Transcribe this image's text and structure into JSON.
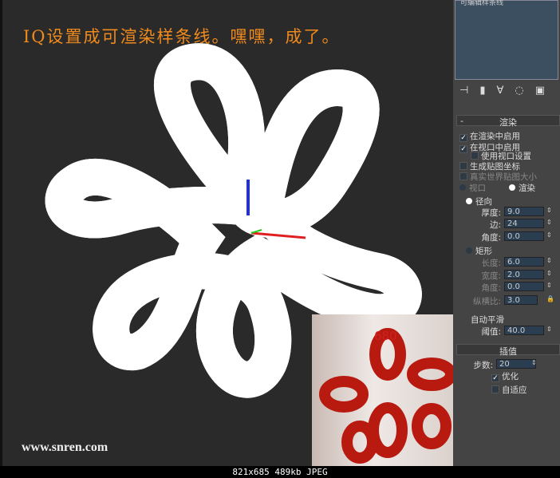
{
  "viewport": {
    "caption": "IQ设置成可渲染样条线。嘿嘿，成了。",
    "watermark": "www.snren.com",
    "photo_label": "680"
  },
  "panel": {
    "list_title": "可编辑样条线",
    "icons": [
      "pin-icon",
      "stack-icon",
      "funnel-icon",
      "lock-icon",
      "config-icon"
    ],
    "rendering": {
      "header": "渲染",
      "collapse": "-",
      "enable_render": {
        "label": "在渲染中启用",
        "checked": true
      },
      "enable_viewport": {
        "label": "在视口中启用",
        "checked": true
      },
      "use_viewport": {
        "label": "使用视口设置",
        "checked": false
      },
      "gen_mapping": {
        "label": "生成贴图坐标",
        "checked": false
      },
      "real_world": {
        "label": "真实世界贴图大小",
        "checked": false
      },
      "mode_viewport": "视口",
      "mode_render": "渲染",
      "radial": "径向",
      "thickness_label": "厚度:",
      "thickness": "9.0",
      "sides_label": "边:",
      "sides": "24",
      "angle_label": "角度:",
      "angle": "0.0",
      "rect": "矩形",
      "length_label": "长度:",
      "length": "6.0",
      "width_label": "宽度:",
      "width": "2.0",
      "rangle_label": "角度:",
      "rangle": "0.0",
      "aspect_label": "纵横比:",
      "aspect": "3.0",
      "auto_smooth": "自动平滑",
      "threshold_label": "阈值:",
      "threshold": "40.0"
    },
    "interp": {
      "header": "插值",
      "steps_label": "步数:",
      "steps": "20",
      "optimize": {
        "label": "优化",
        "checked": true
      },
      "adaptive": {
        "label": "自适应",
        "checked": false
      }
    }
  },
  "status": "821x685 489kb JPEG"
}
